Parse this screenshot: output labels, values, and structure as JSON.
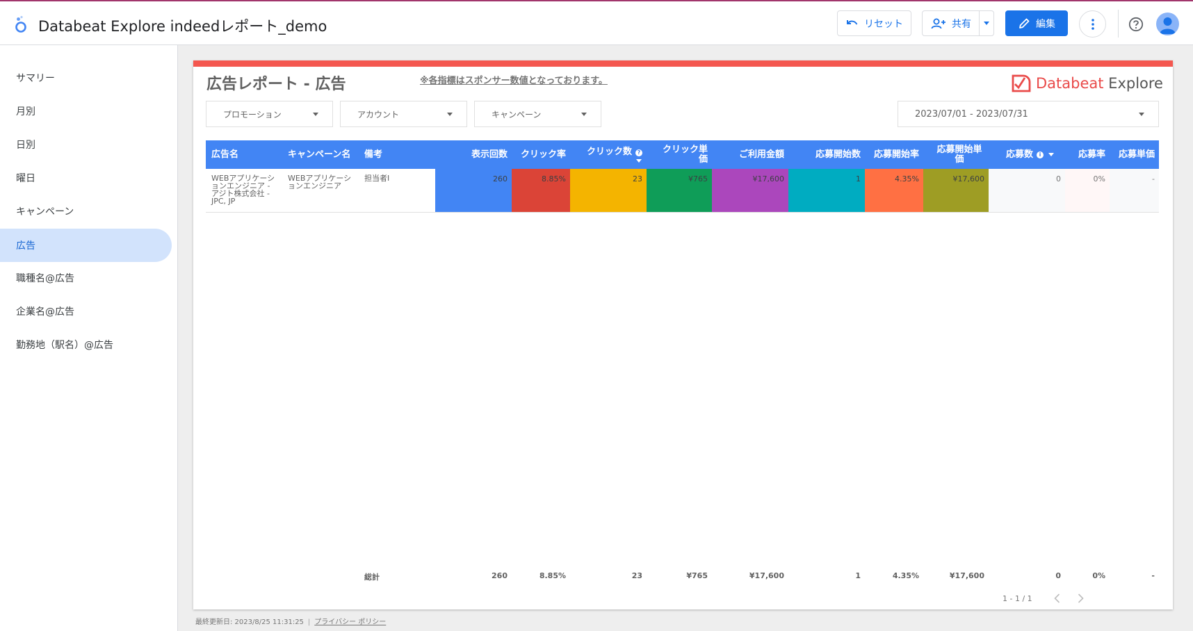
{
  "app": {
    "title": "Databeat Explore indeedレポート_demo"
  },
  "toolbar": {
    "reset_label": "リセット",
    "share_label": "共有",
    "edit_label": "編集"
  },
  "sidebar": {
    "items": [
      {
        "label": "サマリー"
      },
      {
        "label": "月別"
      },
      {
        "label": "日別"
      },
      {
        "label": "曜日"
      },
      {
        "label": "キャンペーン"
      },
      {
        "label": "広告"
      },
      {
        "label": "職種名@広告"
      },
      {
        "label": "企業名@広告"
      },
      {
        "label": "勤務地（駅名）@広告"
      }
    ],
    "active_index": 5
  },
  "report": {
    "title": "広告レポート - 広告",
    "note": "※各指標はスポンサー数値となっております。",
    "brand": {
      "part1": "Databeat",
      "part2": " Explore"
    },
    "filters": {
      "promotion": "プロモーション",
      "account": "アカウント",
      "campaign": "キャンペーン",
      "date_range": "2023/07/01 - 2023/07/31"
    },
    "colors": {
      "accent_bar": "#f4574f",
      "header": "#4285f4"
    },
    "table": {
      "headers": {
        "ad_name": "広告名",
        "campaign_name": "キャンペーン名",
        "remarks": "備考",
        "impressions": "表示回数",
        "ctr": "クリック率",
        "clicks": "クリック数",
        "cpc": "クリック単価",
        "cost": "ご利用金額",
        "apply_starts": "応募開始数",
        "apply_start_rate": "応募開始率",
        "apply_start_cpa": "応募開始単価",
        "applies": "応募数",
        "apply_rate": "応募率",
        "apply_cpa": "応募単価"
      },
      "rows": [
        {
          "ad_name": "WEBアプリケーションエンジニア - アジト株式会社 - JPC, JP",
          "campaign_name": "WEBアプリケーションエンジニア",
          "remarks": "担当者I",
          "impressions": "260",
          "ctr": "8.85%",
          "clicks": "23",
          "cpc": "¥765",
          "cost": "¥17,600",
          "apply_starts": "1",
          "apply_start_rate": "4.35%",
          "apply_start_cpa": "¥17,600",
          "applies": "0",
          "apply_rate": "0%",
          "apply_cpa": "-"
        }
      ],
      "cell_colors": {
        "impressions": "#4285f4",
        "ctr": "#db4437",
        "clicks": "#f4b400",
        "cpc": "#0f9d58",
        "cost": "#ab47bc",
        "apply_starts": "#00acc1",
        "apply_start_rate": "#ff7043",
        "apply_start_cpa": "#9e9d24"
      },
      "totals": {
        "label": "総計",
        "impressions": "260",
        "ctr": "8.85%",
        "clicks": "23",
        "cpc": "¥765",
        "cost": "¥17,600",
        "apply_starts": "1",
        "apply_start_rate": "4.35%",
        "apply_start_cpa": "¥17,600",
        "applies": "0",
        "apply_rate": "0%",
        "apply_cpa": "-"
      },
      "pagination": "1 - 1 / 1"
    }
  },
  "footer": {
    "updated": "最終更新日: 2023/8/25 11:31:25",
    "privacy": "プライバシー ポリシー"
  }
}
